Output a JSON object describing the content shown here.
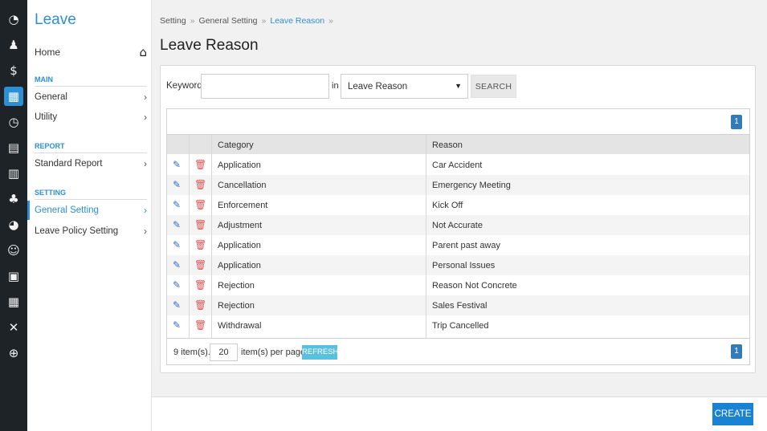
{
  "sidebar": {
    "title": "Leave",
    "home": "Home",
    "sections": {
      "main": "MAIN",
      "report": "REPORT",
      "setting": "SETTING"
    },
    "items": {
      "general": "General",
      "utility": "Utility",
      "standard_report": "Standard Report",
      "general_setting": "General Setting",
      "leave_policy_setting": "Leave Policy Setting"
    }
  },
  "breadcrumb": {
    "b1": "Setting",
    "b2": "General Setting",
    "b3": "Leave Reason"
  },
  "page_title": "Leave Reason",
  "search": {
    "keyword_label": "Keyword:",
    "keyword_value": "",
    "in_label": "in",
    "field_selected": "Leave Reason",
    "button": "SEARCH"
  },
  "grid": {
    "columns": {
      "category": "Category",
      "reason": "Reason"
    },
    "rows": [
      {
        "category": "Application",
        "reason": "Car Accident"
      },
      {
        "category": "Cancellation",
        "reason": "Emergency Meeting"
      },
      {
        "category": "Enforcement",
        "reason": "Kick Off"
      },
      {
        "category": "Adjustment",
        "reason": "Not Accurate"
      },
      {
        "category": "Application",
        "reason": "Parent past away"
      },
      {
        "category": "Application",
        "reason": "Personal Issues"
      },
      {
        "category": "Rejection",
        "reason": "Reason Not Concrete"
      },
      {
        "category": "Rejection",
        "reason": "Sales Festival"
      },
      {
        "category": "Withdrawal",
        "reason": "Trip Cancelled"
      }
    ],
    "page_number": "1",
    "items_count_text": "9 item(s).",
    "per_page_value": "20",
    "per_page_label": "item(s) per page.",
    "refresh_label": "REFRESH"
  },
  "create_label": "CREATE",
  "colors": {
    "accent": "#2d8fd5",
    "create": "#1a82d3",
    "refresh": "#5bc0de",
    "icon_bar": "#1d2327"
  }
}
